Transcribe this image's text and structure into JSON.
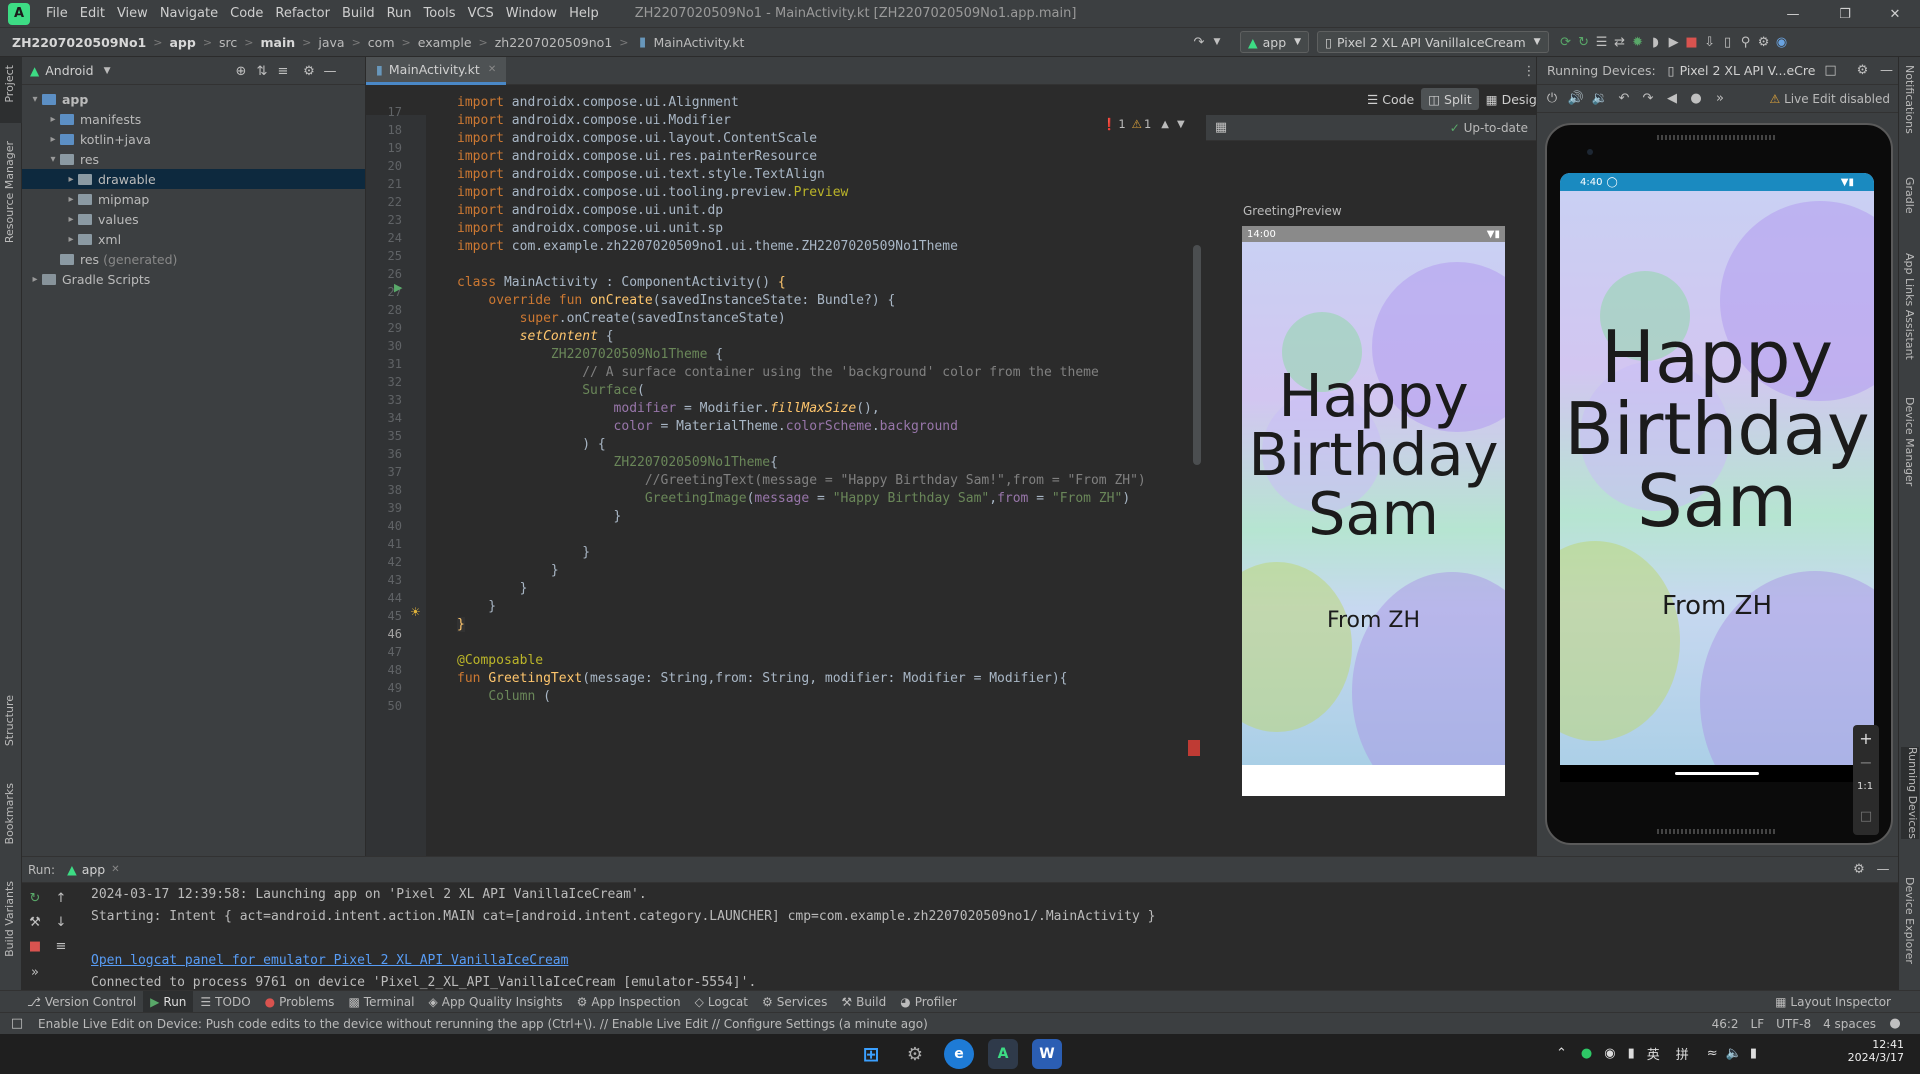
{
  "menubar": {
    "items": [
      "File",
      "Edit",
      "View",
      "Navigate",
      "Code",
      "Refactor",
      "Build",
      "Run",
      "Tools",
      "VCS",
      "Window",
      "Help"
    ],
    "window_title": "ZH2207020509No1 - MainActivity.kt [ZH2207020509No1.app.main]"
  },
  "navbar": {
    "crumbs": [
      "ZH2207020509No1",
      "app",
      "src",
      "main",
      "java",
      "com",
      "example",
      "zh2207020509no1",
      "MainActivity.kt"
    ],
    "run_config": "app",
    "device": "Pixel 2 XL API VanillaIceCream"
  },
  "project": {
    "view": "Android",
    "tree": [
      {
        "label": "app",
        "depth": 0,
        "arrow": "v",
        "type": "module"
      },
      {
        "label": "manifests",
        "depth": 1,
        "arrow": ">",
        "type": "folder"
      },
      {
        "label": "kotlin+java",
        "depth": 1,
        "arrow": ">",
        "type": "folder"
      },
      {
        "label": "res",
        "depth": 1,
        "arrow": "v",
        "type": "res"
      },
      {
        "label": "drawable",
        "depth": 2,
        "arrow": ">",
        "type": "res",
        "selected": true
      },
      {
        "label": "mipmap",
        "depth": 2,
        "arrow": ">",
        "type": "res"
      },
      {
        "label": "values",
        "depth": 2,
        "arrow": ">",
        "type": "res"
      },
      {
        "label": "xml",
        "depth": 2,
        "arrow": ">",
        "type": "res"
      },
      {
        "label": "res",
        "suffix": "(generated)",
        "depth": 1,
        "arrow": "",
        "type": "res"
      },
      {
        "label": "Gradle Scripts",
        "depth": 0,
        "arrow": ">",
        "type": "gradle"
      }
    ]
  },
  "left_strip": {
    "project": "Project",
    "resource_manager": "Resource Manager",
    "structure": "Structure",
    "bookmarks": "Bookmarks",
    "build_variants": "Build Variants"
  },
  "right_strip": {
    "notifications": "Notifications",
    "gradle": "Gradle",
    "app_links": "App Links Assistant",
    "device_manager": "Device Manager",
    "running_devices": "Running Devices",
    "device_explorer": "Device Explorer"
  },
  "editor": {
    "tab": "MainActivity.kt",
    "errors": "1",
    "warnings": "1",
    "mode_code": "Code",
    "mode_split": "Split",
    "mode_design": "Design",
    "status": "Up-to-date",
    "line_start": 17,
    "line_count": 34
  },
  "preview": {
    "label": "GreetingPreview",
    "clock": "14:00",
    "greeting": "Happy Birthday Sam",
    "from": "From ZH"
  },
  "running_devices": {
    "title": "Running Devices:",
    "device_tab": "Pixel 2 XL API V...eCre",
    "live_edit": "Live Edit disabled",
    "clock": "4:40",
    "greeting": "Happy Birthday Sam",
    "from": "From ZH",
    "zoom_label": "1:1"
  },
  "run": {
    "title": "Run:",
    "tab": "app",
    "lines": [
      "2024-03-17 12:39:58: Launching app on 'Pixel 2 XL API VanillaIceCream'.",
      "Starting: Intent { act=android.intent.action.MAIN cat=[android.intent.category.LAUNCHER] cmp=com.example.zh2207020509no1/.MainActivity }",
      "",
      "Open logcat panel for emulator Pixel 2 XL API VanillaIceCream",
      "Connected to process 9761 on device 'Pixel_2_XL_API_VanillaIceCream [emulator-5554]'."
    ]
  },
  "bottom_tabs": [
    "Version Control",
    "Run",
    "TODO",
    "Problems",
    "Terminal",
    "App Quality Insights",
    "App Inspection",
    "Logcat",
    "Services",
    "Build",
    "Profiler"
  ],
  "layout_inspector": "Layout Inspector",
  "status": {
    "message": "Enable Live Edit on Device: Push code edits to the device without rerunning the app (Ctrl+\\). // Enable Live Edit // Configure Settings (a minute ago)",
    "position": "46:2",
    "line_sep": "LF",
    "encoding": "UTF-8",
    "indent": "4 spaces"
  },
  "taskbar": {
    "time": "12:41",
    "date": "2024/3/17",
    "ime1": "英",
    "ime2": "拼"
  }
}
